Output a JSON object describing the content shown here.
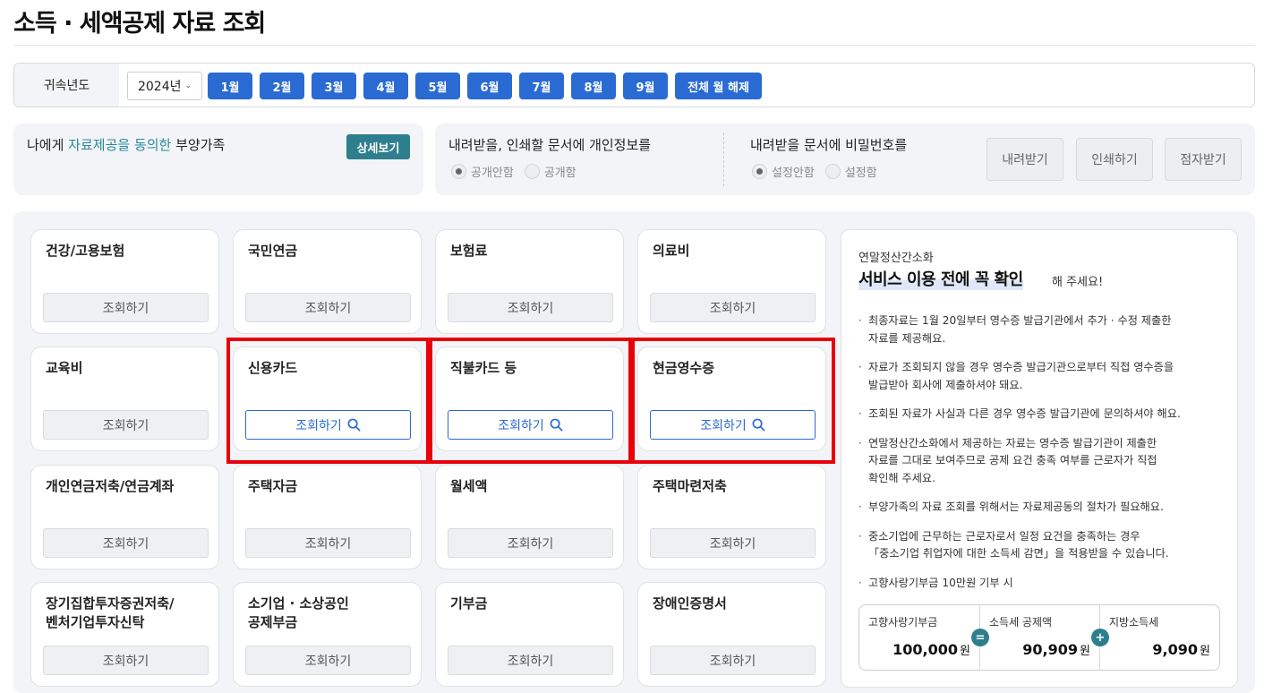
{
  "page": {
    "title": "소득 · 세액공제 자료 조회"
  },
  "period": {
    "label": "귀속년도",
    "year": "2024년",
    "months": [
      "1월",
      "2월",
      "3월",
      "4월",
      "5월",
      "6월",
      "7월",
      "8월",
      "9월"
    ],
    "clear_all": "전체 월 해제"
  },
  "dependents": {
    "prefix": "나에게 ",
    "highlight": "자료제공을 동의한",
    "suffix": " 부양가족",
    "detail_button": "상세보기"
  },
  "privacy": {
    "title": "내려받을, 인쇄할 문서에 개인정보를",
    "options": [
      "공개안함",
      "공개함"
    ],
    "selected": "공개안함"
  },
  "password": {
    "title": "내려받을 문서에 비밀번호를",
    "options": [
      "설정안함",
      "설정함"
    ],
    "selected": "설정안함"
  },
  "actions": {
    "download": "내려받기",
    "print": "인쇄하기",
    "braille": "점자받기"
  },
  "cards": [
    {
      "title": "건강/고용보험",
      "button": "조회하기",
      "enabled": false
    },
    {
      "title": "국민연금",
      "button": "조회하기",
      "enabled": false
    },
    {
      "title": "보험료",
      "button": "조회하기",
      "enabled": false
    },
    {
      "title": "의료비",
      "button": "조회하기",
      "enabled": false
    },
    {
      "title": "교육비",
      "button": "조회하기",
      "enabled": false
    },
    {
      "title": "신용카드",
      "button": "조회하기",
      "enabled": true
    },
    {
      "title": "직불카드 등",
      "button": "조회하기",
      "enabled": true
    },
    {
      "title": "현금영수증",
      "button": "조회하기",
      "enabled": true
    },
    {
      "title": "개인연금저축/연금계좌",
      "button": "조회하기",
      "enabled": false
    },
    {
      "title": "주택자금",
      "button": "조회하기",
      "enabled": false
    },
    {
      "title": "월세액",
      "button": "조회하기",
      "enabled": false
    },
    {
      "title": "주택마련저축",
      "button": "조회하기",
      "enabled": false
    },
    {
      "title": "장기집합투자증권저축/\n벤처기업투자신탁",
      "button": "조회하기",
      "enabled": false
    },
    {
      "title": "소기업 · 소상공인\n공제부금",
      "button": "조회하기",
      "enabled": false
    },
    {
      "title": "기부금",
      "button": "조회하기",
      "enabled": false
    },
    {
      "title": "장애인증명서",
      "button": "조회하기",
      "enabled": false
    }
  ],
  "info": {
    "subtitle": "연말정산간소화",
    "headline": "서비스 이용 전에 꼭 확인",
    "headline_tail": "해 주세요!",
    "notes": [
      "최종자료는 1월 20일부터 영수증 발급기관에서 추가 · 수정 제출한\n자료를 제공해요.",
      "자료가 조회되지 않을 경우 영수증 발급기관으로부터 직접 영수증을\n발급받아 회사에 제출하셔야 돼요.",
      "조회된 자료가 사실과 다른 경우 영수증 발급기관에 문의하셔야 해요.",
      "연말정산간소화에서 제공하는 자료는 영수증 발급기관이 제출한\n자료를 그대로 보여주므로 공제 요건 충족 여부를 근로자가 직접\n확인해 주세요.",
      "부양가족의 자료 조회를 위해서는 자료제공동의 절차가 필요해요.",
      "중소기업에 근무하는 근로자로서 일정 요건을 충족하는 경우\n「중소기업 취업자에 대한 소득세 감면」을 적용받을 수 있습니다.",
      "고향사랑기부금 10만원 기부 시"
    ],
    "calc": [
      {
        "label": "고향사랑기부금",
        "value": "100,000",
        "unit": "원"
      },
      {
        "label": "소득세 공제액",
        "value": "90,909",
        "unit": "원"
      },
      {
        "label": "지방소득세",
        "value": "9,090",
        "unit": "원"
      }
    ],
    "operators": [
      "=",
      "+"
    ]
  },
  "highlight_color": "#e8000b",
  "accent_color": "#2a6ad3",
  "teal_color": "#2e7f8d"
}
